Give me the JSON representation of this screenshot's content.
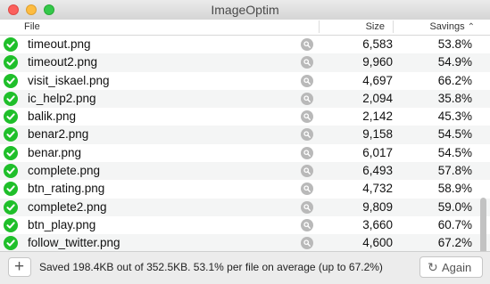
{
  "window": {
    "title": "ImageOptim"
  },
  "columns": {
    "file": "File",
    "size": "Size",
    "savings": "Savings"
  },
  "files": [
    {
      "name": "timeout.png",
      "size": "6,583",
      "savings": "53.8%"
    },
    {
      "name": "timeout2.png",
      "size": "9,960",
      "savings": "54.9%"
    },
    {
      "name": "visit_iskael.png",
      "size": "4,697",
      "savings": "66.2%"
    },
    {
      "name": "ic_help2.png",
      "size": "2,094",
      "savings": "35.8%"
    },
    {
      "name": "balik.png",
      "size": "2,142",
      "savings": "45.3%"
    },
    {
      "name": "benar2.png",
      "size": "9,158",
      "savings": "54.5%"
    },
    {
      "name": "benar.png",
      "size": "6,017",
      "savings": "54.5%"
    },
    {
      "name": "complete.png",
      "size": "6,493",
      "savings": "57.8%"
    },
    {
      "name": "btn_rating.png",
      "size": "4,732",
      "savings": "58.9%"
    },
    {
      "name": "complete2.png",
      "size": "9,809",
      "savings": "59.0%"
    },
    {
      "name": "btn_play.png",
      "size": "3,660",
      "savings": "60.7%"
    },
    {
      "name": "follow_twitter.png",
      "size": "4,600",
      "savings": "67.2%"
    }
  ],
  "footer": {
    "add_label": "+",
    "status": "Saved 198.4KB out of 352.5KB. 53.1% per file on average (up to 67.2%)",
    "again_label": "Again"
  },
  "colors": {
    "accent_green": "#1fbf2a",
    "close": "#fc605c",
    "minimize": "#fdbc40",
    "maximize": "#34c84a"
  },
  "icons": {
    "row_status": "checkmark-icon",
    "row_action": "magnifier-icon",
    "again": "reload-icon"
  }
}
